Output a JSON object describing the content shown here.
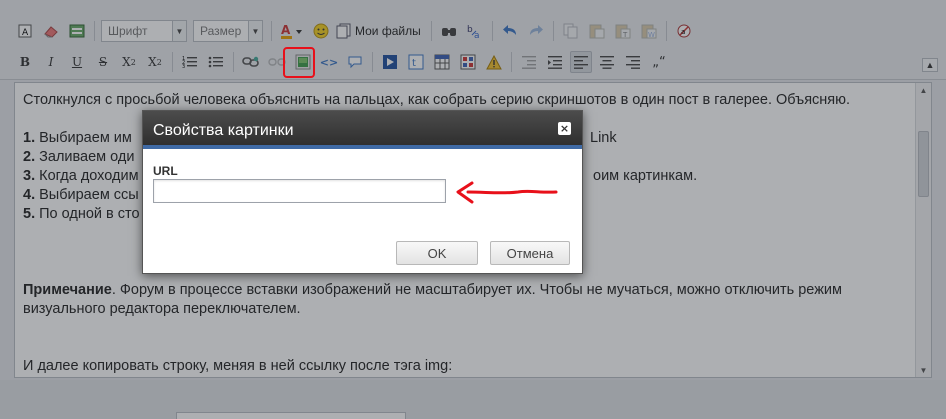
{
  "toolbar": {
    "font_label": "Шрифт",
    "size_label": "Размер",
    "files_label": "Мои файлы"
  },
  "editor": {
    "line1": "Столкнулся с просьбой человека объяснить на пальцах, как собрать серию скриншотов в один пост в галерее. Объясняю.",
    "steps": [
      {
        "num": "1.",
        "text": " Выбираем им",
        "tail": "Link"
      },
      {
        "num": "2.",
        "text": " Заливаем оди",
        "tail": ""
      },
      {
        "num": "3.",
        "text": " Когда доходим",
        "tail": "оим картинкам."
      },
      {
        "num": "4.",
        "text": " Выбираем ссы",
        "tail": ""
      },
      {
        "num": "5.",
        "text": " По одной в сто",
        "tail": ""
      }
    ],
    "note_label": "Примечание",
    "note_text": ". Форум в процессе вставки изображений не масштабирует их. Чтобы не мучаться, можно отключить режим",
    "note_text2": "визуального редактора переключателем.",
    "last_line": "И далее копировать строку, меняя в ней ссылку после тэга img:"
  },
  "dialog": {
    "title": "Свойства картинки",
    "url_label": "URL",
    "url_value": "",
    "ok_label": "OK",
    "cancel_label": "Отмена"
  },
  "colors": {
    "annotation": "#e8101a",
    "dialog_accent": "#3f6aa5"
  }
}
